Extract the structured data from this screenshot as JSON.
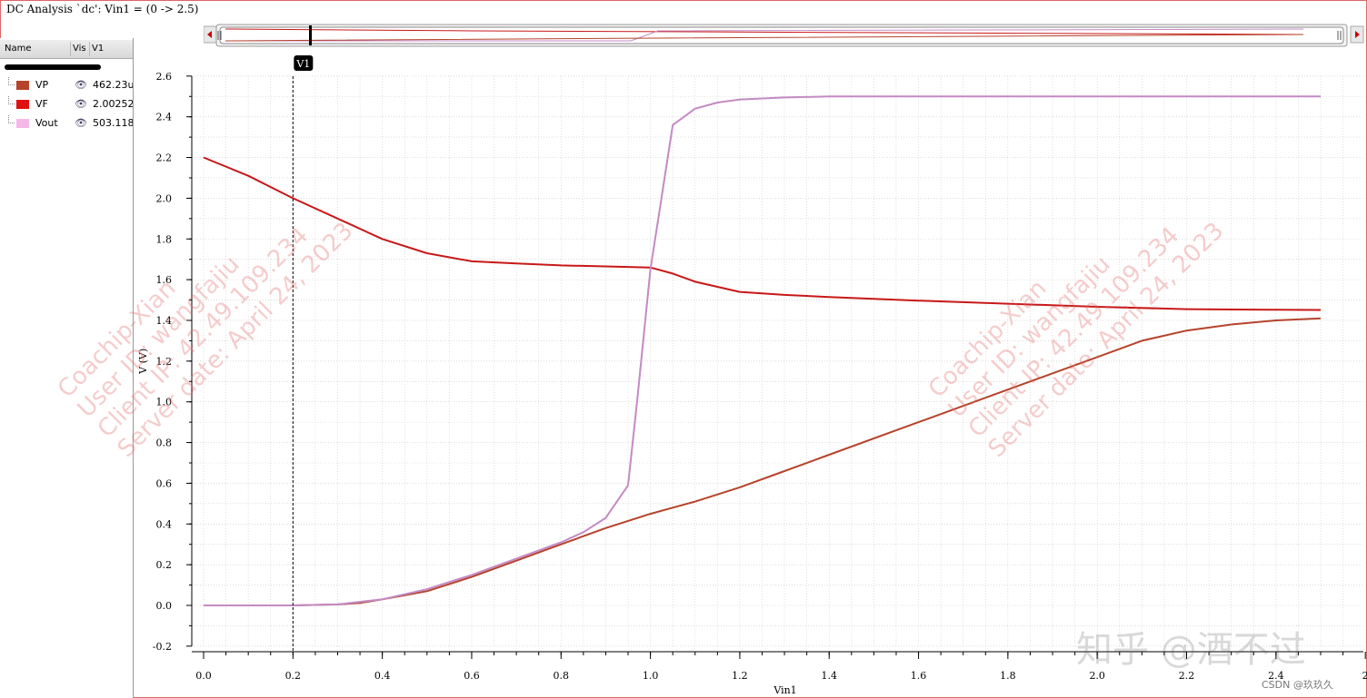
{
  "window": {
    "title": "DC Analysis `dc': Vin1 = (0 -> 2.5)"
  },
  "legend": {
    "headers": {
      "name": "Name",
      "vis": "Vis",
      "v1": "V1"
    },
    "rows": [
      {
        "name": "VP",
        "value": "462.23u",
        "color": "#b5432b"
      },
      {
        "name": "VF",
        "value": "2.00252",
        "color": "#e01010"
      },
      {
        "name": "Vout",
        "value": "503.118",
        "color": "#f4b8e8"
      }
    ]
  },
  "cursor": {
    "label": "V1",
    "x": 0.2
  },
  "watermark": {
    "lines": [
      "Coachip-Xian",
      "User ID: wangfajiu",
      "Client IP: 42.49.109.234",
      "Server date: April 24, 2023"
    ]
  },
  "overlay": {
    "zhihu": "知乎 @酒不过",
    "csdn": "CSDN @玖玖久"
  },
  "colors": {
    "vp": "#b5432b",
    "vf": "#c81818",
    "vout": "#c48ac4",
    "grid": "#c8c8c8",
    "cursor": "#000000"
  },
  "chart_data": {
    "type": "line",
    "xlabel": "Vin1",
    "ylabel": "V (V)",
    "xlim": [
      0,
      2.5
    ],
    "ylim": [
      -0.2,
      2.6
    ],
    "x_ticks": [
      "0.0",
      "0.2",
      "0.4",
      "0.6",
      "0.8",
      "1.0",
      "1.2",
      "1.4",
      "1.6",
      "1.8",
      "2.0",
      "2.2",
      "2.4",
      "2"
    ],
    "y_ticks": [
      "2.6",
      "2.4",
      "2.2",
      "2.0",
      "1.8",
      "1.6",
      "1.4",
      "1.2",
      "1.0",
      "0.8",
      "0.6",
      "0.4",
      "0.2",
      "0.0",
      "-0.2"
    ],
    "grid": true,
    "series": [
      {
        "name": "VF",
        "x": [
          0,
          0.1,
          0.2,
          0.3,
          0.4,
          0.5,
          0.6,
          0.7,
          0.8,
          0.9,
          1.0,
          1.05,
          1.1,
          1.2,
          1.3,
          1.4,
          1.6,
          1.8,
          2.0,
          2.2,
          2.4,
          2.5
        ],
        "y": [
          2.2,
          2.11,
          2.0,
          1.9,
          1.8,
          1.73,
          1.69,
          1.68,
          1.67,
          1.665,
          1.66,
          1.63,
          1.59,
          1.54,
          1.525,
          1.515,
          1.497,
          1.482,
          1.467,
          1.455,
          1.452,
          1.451
        ]
      },
      {
        "name": "VP",
        "x": [
          0,
          0.2,
          0.3,
          0.35,
          0.4,
          0.5,
          0.6,
          0.7,
          0.8,
          0.9,
          1.0,
          1.05,
          1.1,
          1.2,
          1.3,
          1.4,
          1.6,
          1.8,
          2.0,
          2.1,
          2.2,
          2.3,
          2.4,
          2.5
        ],
        "y": [
          0.0,
          0.0,
          0.005,
          0.012,
          0.03,
          0.07,
          0.14,
          0.22,
          0.3,
          0.38,
          0.45,
          0.48,
          0.51,
          0.58,
          0.66,
          0.74,
          0.9,
          1.06,
          1.22,
          1.3,
          1.35,
          1.38,
          1.4,
          1.41
        ]
      },
      {
        "name": "Vout",
        "x": [
          0,
          0.2,
          0.3,
          0.4,
          0.5,
          0.6,
          0.7,
          0.8,
          0.85,
          0.9,
          0.95,
          0.97,
          1.0,
          1.05,
          1.1,
          1.15,
          1.2,
          1.3,
          1.4,
          1.6,
          2.0,
          2.5
        ],
        "y": [
          0.0,
          0.0,
          0.005,
          0.03,
          0.08,
          0.15,
          0.23,
          0.31,
          0.36,
          0.43,
          0.59,
          1.0,
          1.65,
          2.36,
          2.44,
          2.47,
          2.485,
          2.495,
          2.5,
          2.5,
          2.5,
          2.5
        ]
      }
    ]
  }
}
